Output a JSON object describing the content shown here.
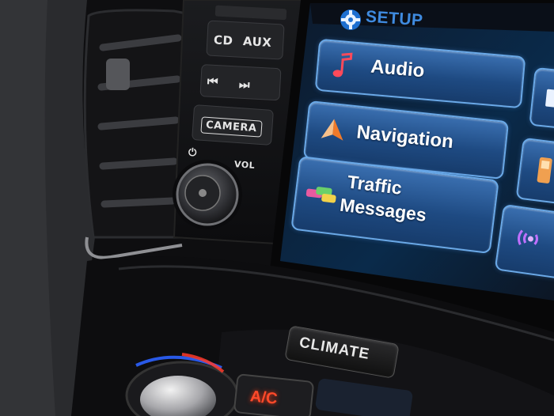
{
  "screen": {
    "title": "SETUP",
    "menu": {
      "audio": "Audio",
      "navigation": "Navigation",
      "traffic_line1": "Traffic",
      "traffic_line2": "Messages"
    },
    "icons": [
      "gear-icon",
      "music-note-icon",
      "navigation-arrow-icon",
      "traffic-cars-icon",
      "phone-icon",
      "bluetooth-signal-icon"
    ]
  },
  "console": {
    "cd": "CD",
    "aux": "AUX",
    "prev": "⏮",
    "next": "⏭",
    "camera": "CAMERA",
    "power": "⏻",
    "vol": "VOL"
  },
  "climate": {
    "label": "CLIMATE",
    "ac": "A/C"
  },
  "colors": {
    "button_blue": "#1e4a82",
    "button_border": "#6aa9e8",
    "title_blue": "#3f8be0",
    "ac_red": "#ff4a2a"
  }
}
